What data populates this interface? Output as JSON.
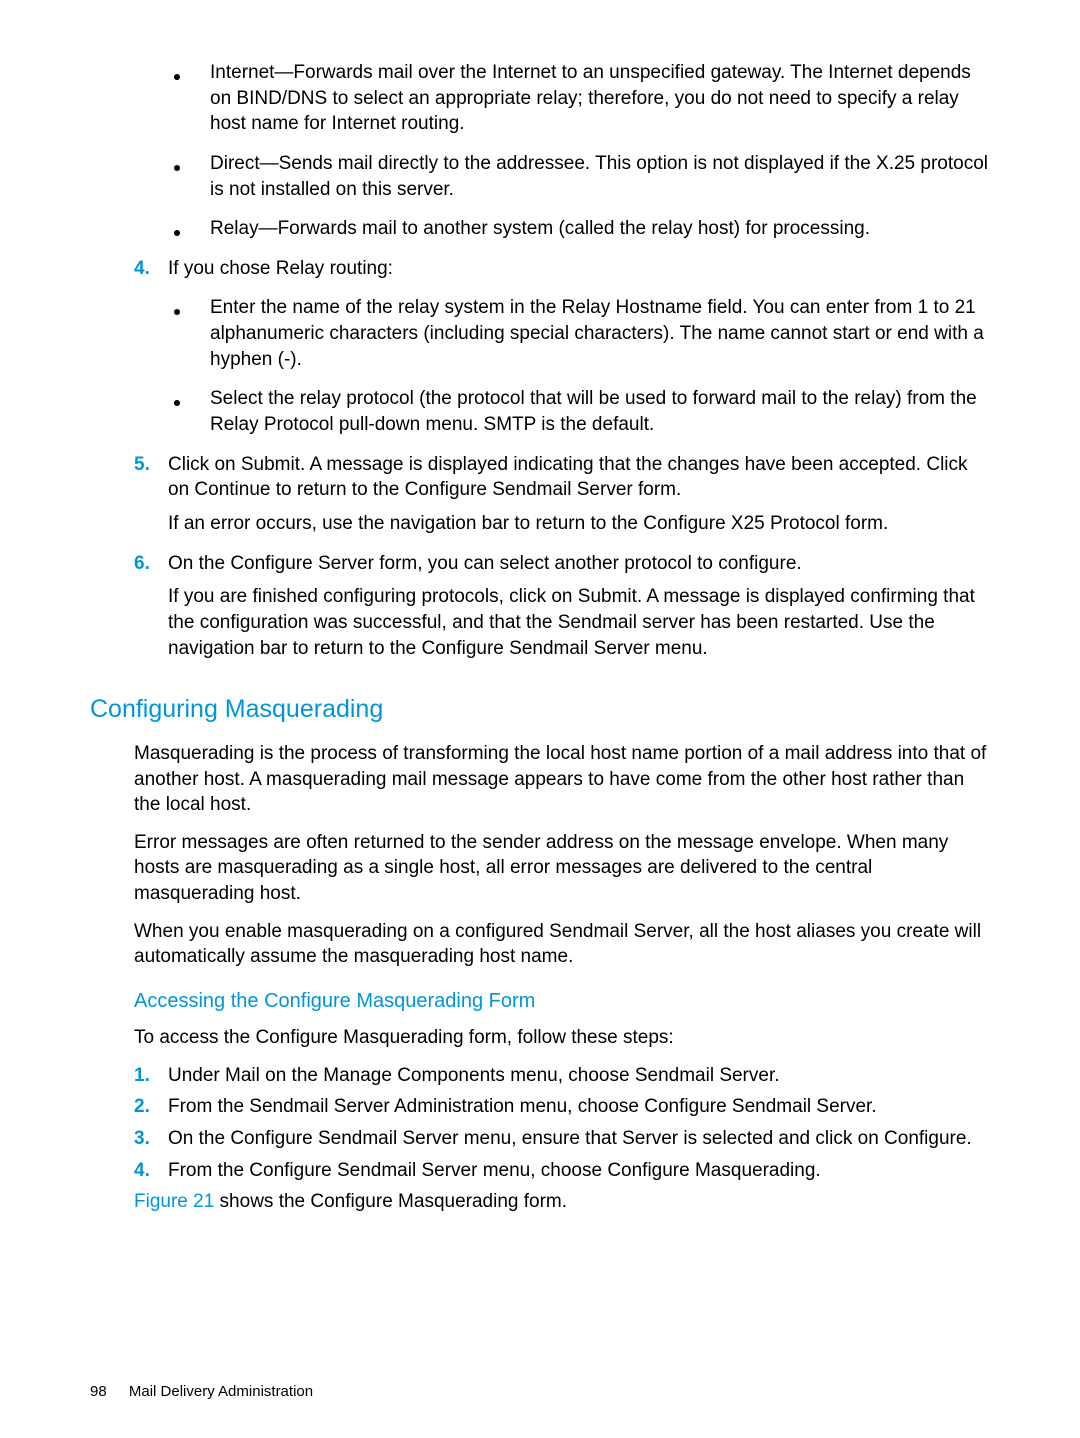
{
  "bullets3": {
    "b1": "Internet—Forwards mail over the Internet to an unspecified gateway. The Internet depends on BIND/DNS to select an appropriate relay; therefore, you do not need to specify a relay host name for Internet routing.",
    "b2": "Direct—Sends mail directly to the addressee. This option is not displayed if the X.25 protocol is not installed on this server.",
    "b3": "Relay—Forwards mail to another system (called the relay host) for processing."
  },
  "step4": {
    "num": "4.",
    "lead": "If you chose Relay routing:",
    "b1": "Enter the name of the relay system in the Relay Hostname field. You can enter from 1 to 21 alphanumeric characters (including special characters). The name cannot start or end with a hyphen (-).",
    "b2": "Select the relay protocol (the protocol that will be used to forward mail to the relay) from the Relay Protocol pull-down menu. SMTP is the default."
  },
  "step5": {
    "num": "5.",
    "p1": "Click on Submit. A message is displayed indicating that the changes have been accepted. Click on Continue to return to the Configure Sendmail Server form.",
    "p2": "If an error occurs, use the navigation bar to return to the Configure X25 Protocol form."
  },
  "step6": {
    "num": "6.",
    "p1": "On the Configure Server form, you can select another protocol to configure.",
    "p2": "If you are finished configuring protocols, click on Submit. A message is displayed confirming that the configuration was successful, and that the Sendmail server has been restarted. Use the navigation bar to return to the Configure Sendmail Server menu."
  },
  "sec1": {
    "title": "Configuring Masquerading",
    "p1": "Masquerading is the process of transforming the local host name portion of a mail address into that of another host. A masquerading mail message appears to have come from the other host rather than the local host.",
    "p2": "Error messages are often returned to the sender address on the message envelope. When many hosts are masquerading as a single host, all error messages are delivered to the central masquerading host.",
    "p3": "When you enable masquerading on a configured Sendmail Server, all the host aliases you create will automatically assume the masquerading host name."
  },
  "sec2": {
    "title": "Accessing the Configure Masquerading Form",
    "lead": "To access the Configure Masquerading form, follow these steps:",
    "s1n": "1.",
    "s1": "Under Mail on the Manage Components menu, choose Sendmail Server.",
    "s2n": "2.",
    "s2": "From the Sendmail Server Administration menu, choose Configure Sendmail Server.",
    "s3n": "3.",
    "s3": "On the Configure Sendmail Server menu, ensure that Server is selected and click on Configure.",
    "s4n": "4.",
    "s4": "From the Configure Sendmail Server menu, choose Configure Masquerading.",
    "figref": "Figure 21",
    "figtail": " shows the Configure Masquerading form."
  },
  "footer": {
    "page": "98",
    "chapter": "Mail Delivery Administration"
  }
}
